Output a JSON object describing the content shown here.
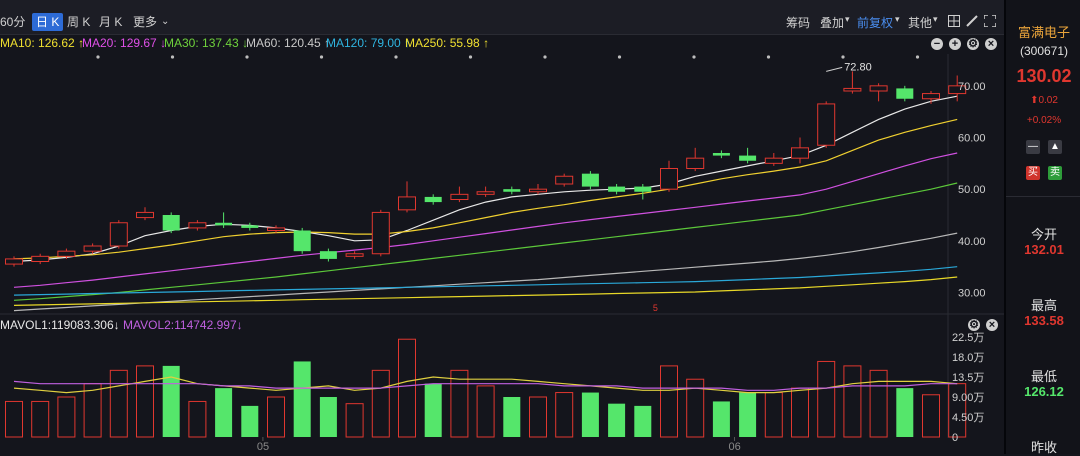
{
  "toolbar": {
    "tabs": [
      {
        "label": "60分",
        "active": false
      },
      {
        "label": "日 K",
        "active": true
      },
      {
        "label": "周 K",
        "active": false
      },
      {
        "label": "月 K",
        "active": false
      },
      {
        "label": "更多",
        "active": false
      }
    ],
    "chips": "筹码",
    "overlay": "叠加",
    "adjust": "前复权",
    "other": "其他"
  },
  "ma_legend": [
    {
      "label": "MA10: 126.62",
      "arrow": "↑",
      "color": "#f0e030"
    },
    {
      "label": "MA20: 129.67",
      "arrow": "↓",
      "color": "#e050e8"
    },
    {
      "label": "MA30: 137.43",
      "arrow": "↓",
      "color": "#6fd23c"
    },
    {
      "label": "MA60: 120.45",
      "arrow": "↑",
      "color": "#c8c8c8"
    },
    {
      "label": "MA120: 79.00",
      "arrow": "↑",
      "color": "#2fb4e0"
    },
    {
      "label": "MA250: 55.98",
      "arrow": "↑",
      "color": "#f0e030"
    }
  ],
  "vol_legend": [
    {
      "label": "MAVOL1:119083.306",
      "arrow": "↓",
      "color": "#e8e8e8"
    },
    {
      "label": "MAVOL2:114742.997",
      "arrow": "↓",
      "color": "#c060e0"
    }
  ],
  "stock": {
    "name": "富满电子",
    "code": "(300671)",
    "price": "130.02",
    "change": "0.02",
    "change_pct": "+0.02%",
    "minus": "—",
    "buy": "买",
    "sell": "卖",
    "open_label": "今开",
    "open_value": "132.01",
    "high_label": "最高",
    "high_value": "133.58",
    "low_label": "最低",
    "low_value": "126.12",
    "prev_label": "昨收"
  },
  "colors": {
    "up": "#e0372f",
    "down": "#55e66b",
    "bg": "#14151c"
  },
  "chart_data": {
    "type": "candlestick",
    "price_axis_ticks": [
      "70.00",
      "60.00",
      "50.00",
      "40.00",
      "30.00"
    ],
    "price_axis_values": [
      70,
      60,
      50,
      40,
      30
    ],
    "ylim": [
      27,
      75
    ],
    "volume_axis_ticks": [
      "22.5万",
      "18.0万",
      "13.5万",
      "9.00万",
      "4.50万",
      "0"
    ],
    "volume_axis_values": [
      22.5,
      18.0,
      13.5,
      9.0,
      4.5,
      0
    ],
    "volume_ylim": [
      0,
      22.5
    ],
    "x_tick_labels": [
      "05",
      "06"
    ],
    "x_tick_index": [
      9.5,
      27.5
    ],
    "marker_index": 24.5,
    "marker_label": "5",
    "max_annotation": {
      "label": "72.80",
      "index": 31,
      "value": 72.8
    },
    "candles": [
      {
        "o": 35.5,
        "c": 36.5,
        "h": 37.0,
        "l": 35.0,
        "v": 8.0
      },
      {
        "o": 36.0,
        "c": 37.0,
        "h": 37.5,
        "l": 35.5,
        "v": 8.0
      },
      {
        "o": 37.0,
        "c": 38.0,
        "h": 38.5,
        "l": 36.5,
        "v": 9.0
      },
      {
        "o": 38.0,
        "c": 39.0,
        "h": 39.5,
        "l": 37.5,
        "v": 12.0
      },
      {
        "o": 39.0,
        "c": 43.5,
        "h": 44.0,
        "l": 38.5,
        "v": 15.0
      },
      {
        "o": 44.5,
        "c": 45.5,
        "h": 46.5,
        "l": 44.0,
        "v": 16.0
      },
      {
        "o": 45.0,
        "c": 42.0,
        "h": 45.5,
        "l": 41.5,
        "v": 16.0
      },
      {
        "o": 42.5,
        "c": 43.5,
        "h": 44.0,
        "l": 42.0,
        "v": 8.0
      },
      {
        "o": 43.5,
        "c": 43.0,
        "h": 45.5,
        "l": 42.5,
        "v": 11.0
      },
      {
        "o": 43.0,
        "c": 42.5,
        "h": 43.5,
        "l": 42.0,
        "v": 7.0
      },
      {
        "o": 42.0,
        "c": 42.5,
        "h": 43.0,
        "l": 41.5,
        "v": 9.0
      },
      {
        "o": 42.0,
        "c": 38.0,
        "h": 42.5,
        "l": 37.5,
        "v": 17.0
      },
      {
        "o": 38.0,
        "c": 36.5,
        "h": 38.5,
        "l": 36.0,
        "v": 9.0
      },
      {
        "o": 37.0,
        "c": 37.5,
        "h": 38.0,
        "l": 36.5,
        "v": 7.5
      },
      {
        "o": 37.5,
        "c": 45.5,
        "h": 46.0,
        "l": 37.0,
        "v": 15.0
      },
      {
        "o": 46.0,
        "c": 48.5,
        "h": 51.5,
        "l": 45.5,
        "v": 22.0
      },
      {
        "o": 48.5,
        "c": 47.5,
        "h": 49.0,
        "l": 47.0,
        "v": 12.0
      },
      {
        "o": 48.0,
        "c": 49.0,
        "h": 50.5,
        "l": 47.5,
        "v": 15.0
      },
      {
        "o": 49.0,
        "c": 49.5,
        "h": 50.5,
        "l": 48.5,
        "v": 11.5
      },
      {
        "o": 50.0,
        "c": 49.5,
        "h": 50.5,
        "l": 49.0,
        "v": 9.0
      },
      {
        "o": 49.5,
        "c": 50.0,
        "h": 51.0,
        "l": 49.0,
        "v": 9.0
      },
      {
        "o": 51.0,
        "c": 52.5,
        "h": 53.0,
        "l": 50.5,
        "v": 10.0
      },
      {
        "o": 53.0,
        "c": 50.5,
        "h": 53.5,
        "l": 50.0,
        "v": 10.0
      },
      {
        "o": 50.5,
        "c": 49.5,
        "h": 51.0,
        "l": 49.0,
        "v": 7.5
      },
      {
        "o": 50.5,
        "c": 49.5,
        "h": 51.0,
        "l": 48.0,
        "v": 7.0
      },
      {
        "o": 50.0,
        "c": 54.0,
        "h": 55.5,
        "l": 49.5,
        "v": 16.0
      },
      {
        "o": 54.0,
        "c": 56.0,
        "h": 58.0,
        "l": 53.5,
        "v": 13.0
      },
      {
        "o": 57.0,
        "c": 56.5,
        "h": 57.5,
        "l": 56.0,
        "v": 8.0
      },
      {
        "o": 56.5,
        "c": 55.5,
        "h": 58.0,
        "l": 55.0,
        "v": 10.0
      },
      {
        "o": 55.0,
        "c": 56.0,
        "h": 57.0,
        "l": 54.5,
        "v": 10.0
      },
      {
        "o": 56.0,
        "c": 58.0,
        "h": 60.0,
        "l": 55.0,
        "v": 11.0
      },
      {
        "o": 58.5,
        "c": 66.5,
        "h": 67.0,
        "l": 58.0,
        "v": 17.0
      },
      {
        "o": 69.0,
        "c": 69.5,
        "h": 72.8,
        "l": 68.5,
        "v": 16.0
      },
      {
        "o": 69.0,
        "c": 70.0,
        "h": 70.5,
        "l": 67.0,
        "v": 15.0
      },
      {
        "o": 69.5,
        "c": 67.5,
        "h": 70.0,
        "l": 67.0,
        "v": 11.0
      },
      {
        "o": 67.5,
        "c": 68.5,
        "h": 69.0,
        "l": 66.5,
        "v": 9.5
      },
      {
        "o": 68.5,
        "c": 70.0,
        "h": 72.0,
        "l": 67.0,
        "v": 12.0
      }
    ],
    "series": [
      {
        "name": "MA10",
        "color": "#e8e8e8",
        "values": [
          36.0,
          36.3,
          36.8,
          37.5,
          39.0,
          41.0,
          42.0,
          42.8,
          43.2,
          43.0,
          42.5,
          41.8,
          41.0,
          40.0,
          40.2,
          42.0,
          44.0,
          46.0,
          47.5,
          48.5,
          49.0,
          49.5,
          49.8,
          50.0,
          50.2,
          51.0,
          52.5,
          53.5,
          54.5,
          55.5,
          56.5,
          58.5,
          61.0,
          63.5,
          65.5,
          67.0,
          68.0
        ]
      },
      {
        "name": "MA20",
        "color": "#f0d030",
        "values": [
          36.5,
          36.7,
          37.0,
          37.3,
          37.8,
          38.5,
          39.2,
          40.0,
          40.8,
          41.3,
          41.6,
          41.7,
          41.6,
          41.3,
          41.3,
          41.8,
          42.5,
          43.5,
          44.5,
          45.5,
          46.3,
          47.0,
          47.8,
          48.5,
          49.2,
          50.0,
          51.0,
          52.0,
          52.8,
          53.5,
          54.3,
          55.5,
          57.5,
          59.5,
          61.0,
          62.3,
          63.5
        ]
      },
      {
        "name": "MA30",
        "color": "#d050e0",
        "values": [
          31.0,
          31.4,
          31.9,
          32.4,
          33.0,
          33.6,
          34.2,
          34.8,
          35.4,
          36.0,
          36.6,
          37.2,
          37.7,
          38.2,
          38.7,
          39.3,
          40.0,
          40.7,
          41.4,
          42.1,
          42.8,
          43.5,
          44.1,
          44.7,
          45.3,
          45.9,
          46.5,
          47.1,
          47.7,
          48.3,
          48.9,
          50.0,
          51.5,
          53.0,
          54.5,
          55.9,
          57.0
        ]
      },
      {
        "name": "MA60",
        "color": "#5cc83a",
        "values": [
          28.5,
          28.8,
          29.2,
          29.6,
          30.0,
          30.5,
          31.0,
          31.5,
          32.0,
          32.5,
          33.0,
          33.6,
          34.2,
          34.8,
          35.4,
          36.0,
          36.6,
          37.2,
          37.8,
          38.4,
          39.0,
          39.6,
          40.2,
          40.8,
          41.4,
          42.0,
          42.6,
          43.2,
          43.8,
          44.4,
          45.0,
          46.0,
          47.0,
          48.0,
          49.0,
          50.0,
          51.2
        ]
      },
      {
        "name": "MA120",
        "color": "#b8b8b8",
        "values": [
          26.5,
          26.8,
          27.1,
          27.4,
          27.7,
          28.0,
          28.3,
          28.6,
          28.9,
          29.2,
          29.5,
          29.8,
          30.1,
          30.4,
          30.7,
          31.0,
          31.3,
          31.6,
          31.9,
          32.2,
          32.5,
          32.9,
          33.3,
          33.7,
          34.1,
          34.5,
          34.9,
          35.3,
          35.7,
          36.1,
          36.6,
          37.2,
          37.9,
          38.7,
          39.6,
          40.5,
          41.5
        ]
      },
      {
        "name": "MA250",
        "color": "#2aa8d8",
        "values": [
          29.5,
          29.6,
          29.7,
          29.8,
          29.9,
          30.0,
          30.1,
          30.2,
          30.3,
          30.4,
          30.5,
          30.6,
          30.7,
          30.8,
          30.9,
          31.0,
          31.1,
          31.2,
          31.3,
          31.4,
          31.5,
          31.6,
          31.7,
          31.8,
          31.9,
          32.0,
          32.1,
          32.3,
          32.5,
          32.7,
          32.9,
          33.2,
          33.5,
          33.8,
          34.1,
          34.5,
          35.0
        ]
      },
      {
        "name": "MA-yellow-low",
        "color": "#e8d828",
        "values": [
          27.5,
          27.6,
          27.7,
          27.8,
          27.9,
          28.0,
          28.1,
          28.2,
          28.3,
          28.4,
          28.5,
          28.6,
          28.7,
          28.8,
          28.9,
          29.0,
          29.1,
          29.2,
          29.3,
          29.4,
          29.5,
          29.6,
          29.7,
          29.8,
          29.9,
          30.0,
          30.1,
          30.3,
          30.5,
          30.7,
          30.9,
          31.2,
          31.5,
          31.8,
          32.1,
          32.5,
          33.0
        ]
      }
    ],
    "volume_series": [
      {
        "name": "MAVOL1",
        "color": "#e0d040",
        "values": [
          11.0,
          10.5,
          10.0,
          10.5,
          11.5,
          12.5,
          13.5,
          12.0,
          11.5,
          11.0,
          10.5,
          11.0,
          11.5,
          10.5,
          11.0,
          12.5,
          13.5,
          13.0,
          13.0,
          13.0,
          12.5,
          12.0,
          11.5,
          11.0,
          10.5,
          10.5,
          11.0,
          10.5,
          10.0,
          10.0,
          10.5,
          11.0,
          12.0,
          12.5,
          12.5,
          12.5,
          12.0
        ]
      },
      {
        "name": "MAVOL2",
        "color": "#c060e0",
        "values": [
          12.5,
          12.0,
          12.0,
          12.0,
          12.0,
          12.0,
          12.0,
          12.0,
          11.5,
          11.5,
          11.0,
          11.0,
          11.0,
          11.0,
          11.0,
          11.5,
          12.0,
          12.0,
          12.0,
          12.0,
          12.0,
          11.5,
          11.5,
          11.5,
          11.0,
          11.0,
          11.0,
          11.0,
          10.5,
          10.5,
          11.0,
          11.0,
          11.5,
          11.5,
          11.5,
          12.0,
          12.0
        ]
      }
    ]
  }
}
